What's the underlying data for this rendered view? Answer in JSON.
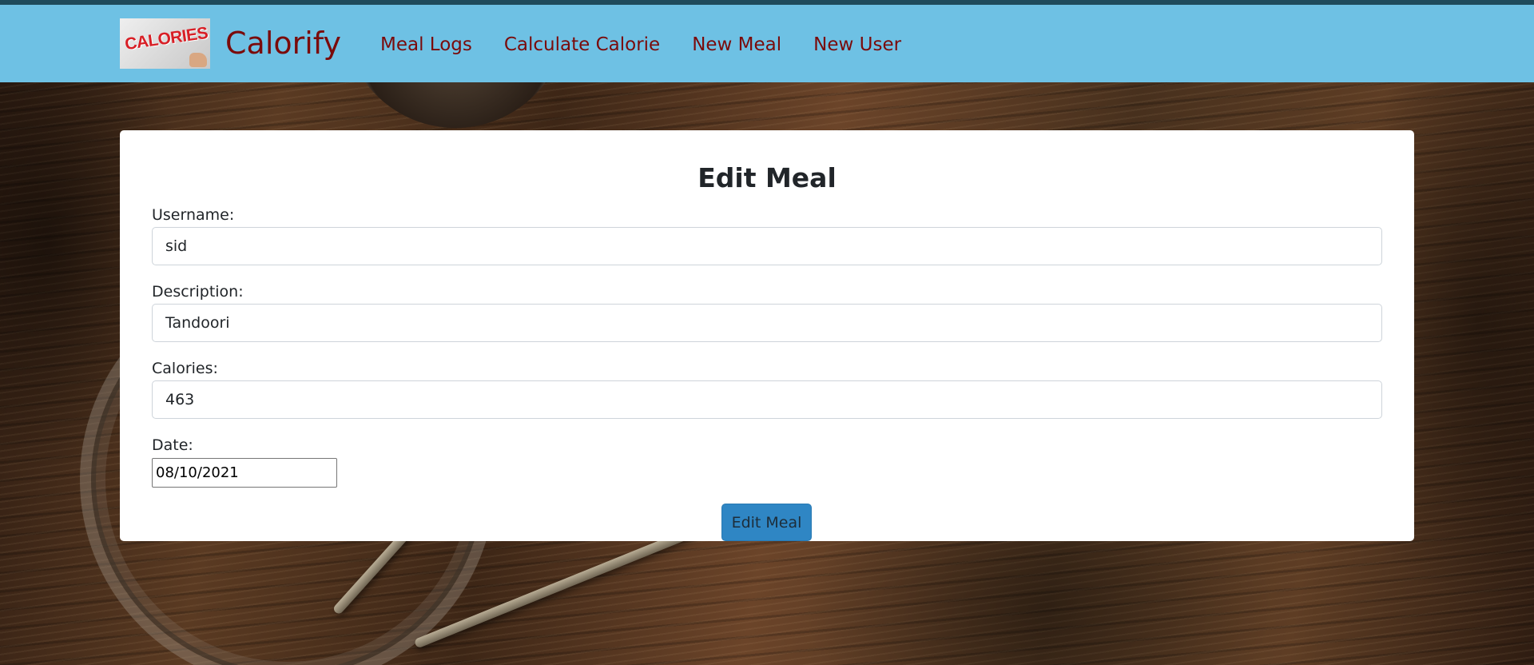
{
  "navbar": {
    "brand_name": "Calorify",
    "logo_text": "CALORIES",
    "links": [
      {
        "label": "Meal Logs"
      },
      {
        "label": "Calculate Calorie"
      },
      {
        "label": "New Meal"
      },
      {
        "label": "New User"
      }
    ]
  },
  "form": {
    "title": "Edit Meal",
    "username": {
      "label": "Username:",
      "value": "sid"
    },
    "description": {
      "label": "Description:",
      "value": "Tandoori"
    },
    "calories": {
      "label": "Calories:",
      "value": "463"
    },
    "date": {
      "label": "Date:",
      "value": "08/10/2021"
    },
    "submit_label": "Edit Meal"
  },
  "colors": {
    "navbar_bg": "#6ec1e4",
    "nav_text": "#7a0b0b",
    "button_bg": "#2f86c4"
  }
}
